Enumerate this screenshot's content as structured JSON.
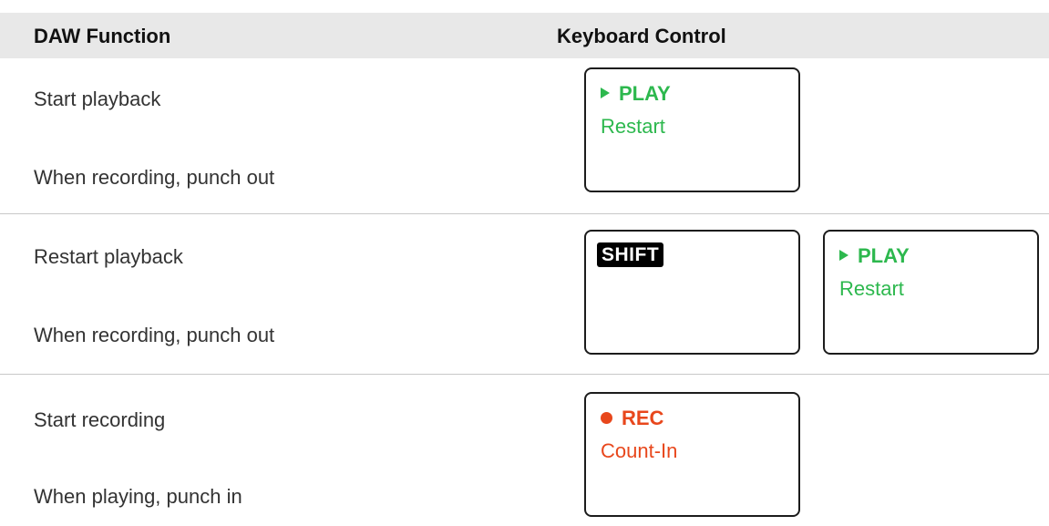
{
  "header": {
    "col_function": "DAW Function",
    "col_control": "Keyboard Control"
  },
  "rows": [
    {
      "desc1": "Start playback",
      "desc2": "When recording, punch out",
      "keys": [
        {
          "icon": "play-icon",
          "label": "PLAY",
          "sub": "Restart",
          "color": "#2db84e"
        }
      ]
    },
    {
      "desc1": "Restart playback",
      "desc2": "When recording, punch out",
      "keys": [
        {
          "modifier": "SHIFT"
        },
        {
          "icon": "play-icon",
          "label": "PLAY",
          "sub": "Restart",
          "color": "#2db84e"
        }
      ]
    },
    {
      "desc1": "Start recording",
      "desc2": "When playing, punch in",
      "keys": [
        {
          "icon": "rec-icon",
          "label": "REC",
          "sub": "Count-In",
          "color": "#e8471c"
        }
      ]
    }
  ]
}
